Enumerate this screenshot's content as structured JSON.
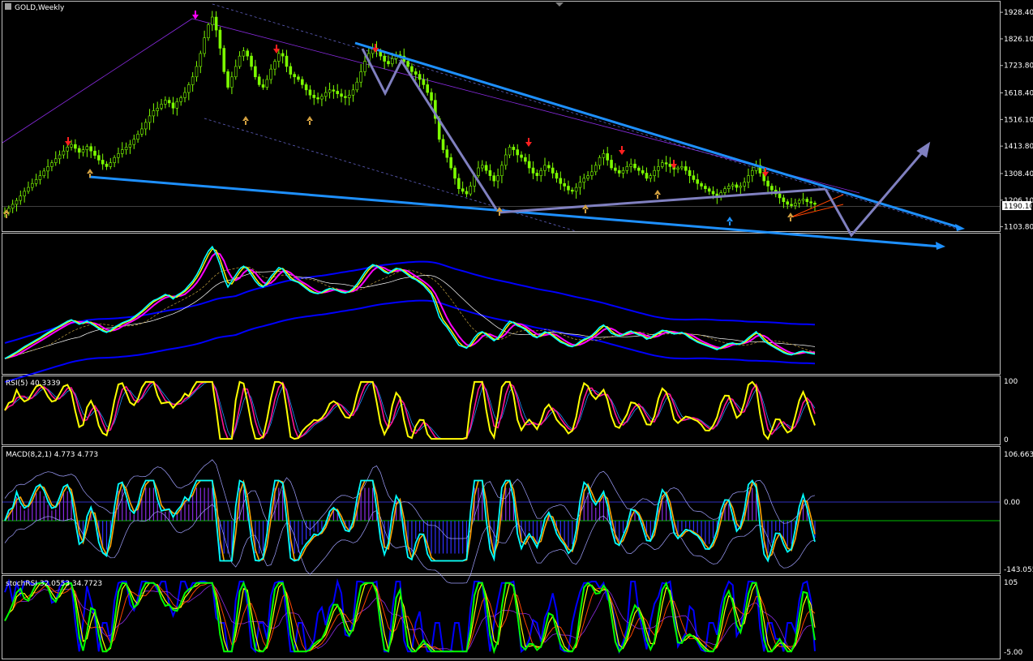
{
  "chart_data": {
    "type": "candlestick",
    "symbol_title": "GOLD,Weekly",
    "price_axis": {
      "ticks": [
        "1928.40",
        "1826.10",
        "1723.80",
        "1618.40",
        "1516.10",
        "1413.80",
        "1308.40",
        "1206.10",
        "1103.80"
      ],
      "current_price": "1190.10",
      "range": [
        1090,
        1960
      ]
    },
    "price_series": [
      1160,
      1175,
      1190,
      1205,
      1222,
      1240,
      1255,
      1270,
      1285,
      1300,
      1318,
      1335,
      1350,
      1365,
      1380,
      1395,
      1410,
      1420,
      1405,
      1390,
      1400,
      1412,
      1395,
      1378,
      1360,
      1345,
      1335,
      1350,
      1370,
      1385,
      1400,
      1410,
      1420,
      1440,
      1460,
      1480,
      1505,
      1530,
      1550,
      1560,
      1575,
      1590,
      1580,
      1560,
      1585,
      1600,
      1620,
      1650,
      1680,
      1720,
      1770,
      1830,
      1880,
      1910,
      1860,
      1790,
      1700,
      1640,
      1680,
      1720,
      1760,
      1780,
      1760,
      1720,
      1680,
      1650,
      1640,
      1670,
      1710,
      1740,
      1770,
      1760,
      1720,
      1690,
      1680,
      1670,
      1650,
      1630,
      1610,
      1600,
      1595,
      1605,
      1620,
      1630,
      1625,
      1615,
      1605,
      1600,
      1610,
      1630,
      1660,
      1700,
      1740,
      1770,
      1790,
      1780,
      1760,
      1740,
      1730,
      1750,
      1765,
      1760,
      1740,
      1720,
      1700,
      1690,
      1670,
      1650,
      1620,
      1590,
      1520,
      1440,
      1400,
      1370,
      1330,
      1290,
      1250,
      1240,
      1230,
      1260,
      1300,
      1330,
      1340,
      1320,
      1300,
      1280,
      1300,
      1340,
      1380,
      1410,
      1400,
      1380,
      1370,
      1355,
      1330,
      1310,
      1300,
      1320,
      1340,
      1330,
      1310,
      1290,
      1270,
      1260,
      1245,
      1240,
      1255,
      1275,
      1290,
      1300,
      1315,
      1340,
      1370,
      1385,
      1360,
      1330,
      1320,
      1310,
      1320,
      1335,
      1345,
      1330,
      1320,
      1310,
      1290,
      1300,
      1320,
      1335,
      1350,
      1345,
      1335,
      1325,
      1330,
      1335,
      1320,
      1300,
      1285,
      1270,
      1260,
      1250,
      1240,
      1230,
      1220,
      1235,
      1250,
      1260,
      1265,
      1255,
      1260,
      1275,
      1300,
      1320,
      1340,
      1310,
      1280,
      1260,
      1245,
      1230,
      1215,
      1200,
      1190,
      1185,
      1195,
      1205,
      1210,
      1200,
      1195,
      1190
    ],
    "top_arrows_red": [
      "1408",
      "1796",
      "1802",
      "1418",
      "1391",
      "1355",
      "1330"
    ],
    "top_arrow_magenta": "1935",
    "panels": [
      {
        "name": "moving-averages-panel",
        "label": ""
      },
      {
        "name": "rsi-panel",
        "label": "RSI(5) 40.3339",
        "ticks": [
          "100",
          "0"
        ]
      },
      {
        "name": "macd-panel",
        "label": "MACD(8,2,1) 4.773 4.773",
        "ticks": [
          "106.663",
          "0.00",
          "-143.055"
        ]
      },
      {
        "name": "stochrsi-panel",
        "label": "stochRSI 32.0553 34.7723",
        "ticks": [
          "105",
          "-5.00"
        ]
      }
    ],
    "colors": {
      "candle": "#7cfc00",
      "trend_blue": "#1e90ff",
      "arrow_grey": "#8080c0",
      "rsi_yellow": "#ffff00",
      "macd_cyan": "#00ffff",
      "ma_magenta": "#ff00ff",
      "ma_blue": "#0000ff"
    }
  }
}
